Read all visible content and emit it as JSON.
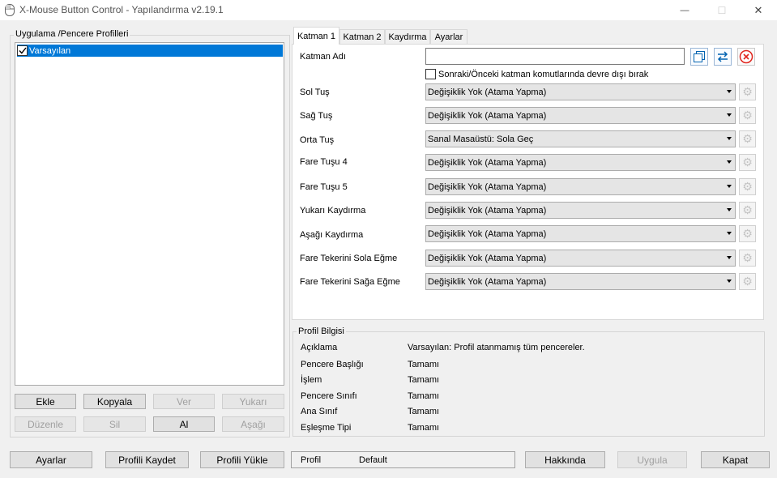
{
  "window": {
    "title": "X-Mouse Button Control - Yapılandırma v2.19.1",
    "controls": [
      "—",
      "☐",
      "✕"
    ]
  },
  "left_panel": {
    "group_title": "Uygulama /Pencere Profilleri",
    "profiles": [
      {
        "label": "Varsayılan",
        "checked": true,
        "selected": true
      }
    ],
    "buttons_row1": [
      {
        "label": "Ekle",
        "enabled": true
      },
      {
        "label": "Kopyala",
        "enabled": true
      },
      {
        "label": "Ver",
        "enabled": false
      },
      {
        "label": "Yukarı",
        "enabled": false
      }
    ],
    "buttons_row2": [
      {
        "label": "Düzenle",
        "enabled": false
      },
      {
        "label": "Sil",
        "enabled": false
      },
      {
        "label": "Al",
        "enabled": true
      },
      {
        "label": "Aşağı",
        "enabled": false
      }
    ]
  },
  "tabs": [
    {
      "label": "Katman 1",
      "active": true
    },
    {
      "label": "Katman 2",
      "active": false
    },
    {
      "label": "Kaydırma",
      "active": false
    },
    {
      "label": "Ayarlar",
      "active": false
    }
  ],
  "layer": {
    "name_label": "Katman Adı",
    "name_value": "",
    "disable_checkbox_label": "Sonraki/Önceki katman komutlarında devre dışı bırak",
    "disable_checked": false,
    "rows": [
      {
        "label": "Sol Tuş",
        "value": "Değişiklik Yok (Atama Yapma)"
      },
      {
        "label": "Sağ Tuş",
        "value": "Değişiklik Yok (Atama Yapma)"
      },
      {
        "label": "Orta Tuş",
        "value": "Sanal Masaüstü: Sola Geç"
      },
      {
        "label": "Fare Tuşu 4",
        "value": "Değişiklik Yok (Atama Yapma)"
      },
      {
        "label": "Fare Tuşu 5",
        "value": "Değişiklik Yok (Atama Yapma)"
      },
      {
        "label": "Yukarı Kaydırma",
        "value": "Değişiklik Yok (Atama Yapma)"
      },
      {
        "label": "Aşağı Kaydırma",
        "value": "Değişiklik Yok (Atama Yapma)"
      },
      {
        "label": "Fare Tekerini Sola Eğme",
        "value": "Değişiklik Yok (Atama Yapma)"
      },
      {
        "label": "Fare Tekerini Sağa Eğme",
        "value": "Değişiklik Yok (Atama Yapma)"
      }
    ],
    "colors": {
      "accent_blue": "#0078d7",
      "delete_red": "#e0261e"
    }
  },
  "profile_info": {
    "group_title": "Profil Bilgisi",
    "rows": [
      {
        "label": "Açıklama",
        "value": "Varsayılan: Profil atanmamış tüm pencereler."
      },
      {
        "label": "Pencere Başlığı",
        "value": "Tamamı"
      },
      {
        "label": "İşlem",
        "value": "Tamamı"
      },
      {
        "label": "Pencere Sınıfı",
        "value": "Tamamı"
      },
      {
        "label": "Ana Sınıf",
        "value": "Tamamı"
      },
      {
        "label": "Eşleşme Tipi",
        "value": "Tamamı"
      }
    ]
  },
  "bottom_bar": {
    "settings_label": "Ayarlar",
    "save_profile_label": "Profili Kaydet",
    "load_profile_label": "Profili Yükle",
    "status_key": "Profil",
    "status_value": "Default",
    "about_label": "Hakkında",
    "apply_label": "Uygula",
    "close_label": "Kapat"
  }
}
